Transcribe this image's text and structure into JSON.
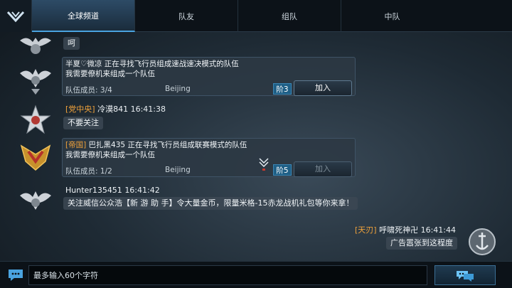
{
  "tabs": [
    {
      "label": "全球频道",
      "active": true
    },
    {
      "label": "队友",
      "active": false
    },
    {
      "label": "组队",
      "active": false
    },
    {
      "label": "中队",
      "active": false
    }
  ],
  "messages": {
    "m1": {
      "text": "呵"
    },
    "team1": {
      "user": "半夏♡微凉",
      "text": "正在寻找飞行员组成速战速决模式的队伍",
      "line2": "我需要僚机来组成一个队伍",
      "members_label": "队伍成员:",
      "members": "3/4",
      "city": "Beijing",
      "rank": "阶3",
      "join_label": "加入"
    },
    "m3": {
      "tag": "[党中央]",
      "user": "冷漠841",
      "time": "16:41:38",
      "text": "不要关注"
    },
    "team2": {
      "tag": "[帝国]",
      "user": "巴扎黑435",
      "text": "正在寻找飞行员组成联赛模式的队伍",
      "line2": "我需要僚机来组成一个队伍",
      "members_label": "队伍成员:",
      "members": "1/2",
      "city": "Beijing",
      "rank": "阶5",
      "join_label": "加入"
    },
    "m5": {
      "user": "Hunter135451",
      "time": "16:41:42",
      "text": "关注威信公众浩【新 游 助 手】令大量金币，限量米格-15赤龙战机礼包等你来拿！"
    },
    "m6": {
      "tag": "[天刃]",
      "user": "呼啸死神卍",
      "time": "16:41:44",
      "text": "广告嚣张到这程度"
    }
  },
  "input": {
    "placeholder": "最多输入60个字符"
  },
  "icons": {
    "back": "chevron-down-icon",
    "chat": "chat-bubble-icon",
    "send": "send-chat-icon"
  },
  "colors": {
    "accent": "#4aa3e0",
    "tag": "#f0a23a",
    "rank_bg": "#1f5f86"
  }
}
